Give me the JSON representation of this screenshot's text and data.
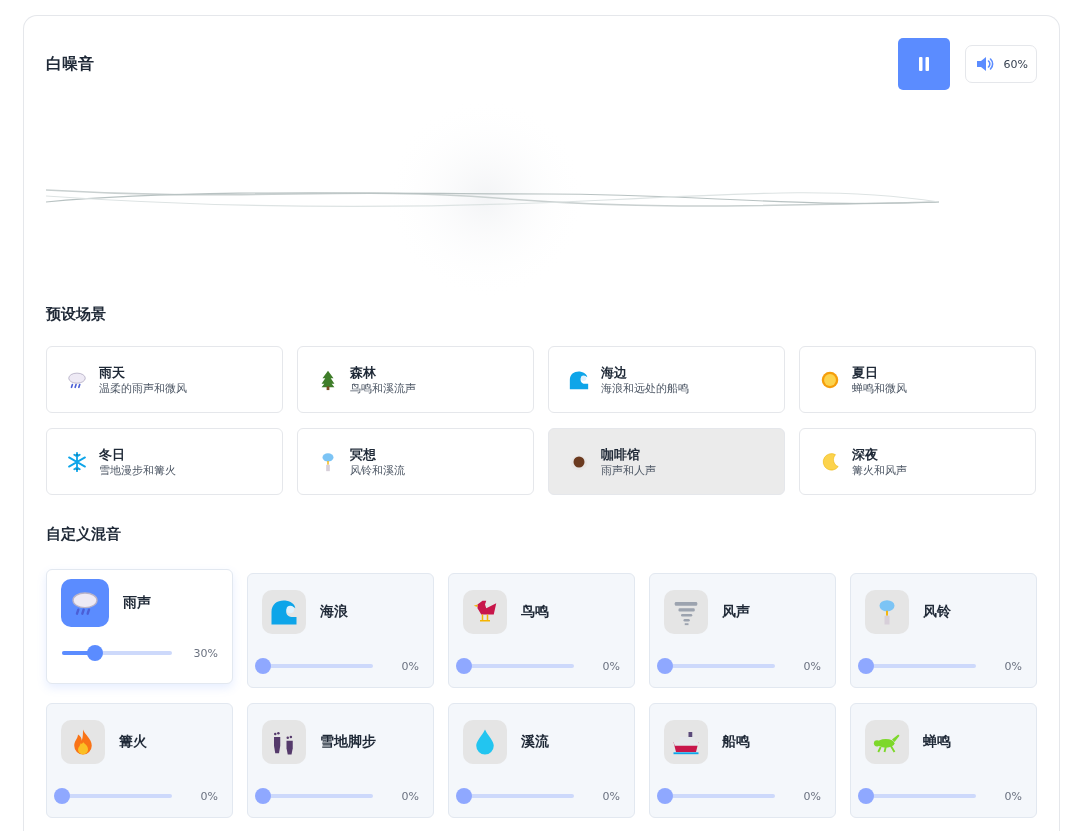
{
  "title": "白噪音",
  "player": {
    "playing": true,
    "volume": "60%"
  },
  "presets_heading": "预设场景",
  "presets": [
    {
      "name": "雨天",
      "description": "温柔的雨声和微风",
      "selected": false
    },
    {
      "name": "森林",
      "description": "鸟鸣和溪流声",
      "selected": false
    },
    {
      "name": "海边",
      "description": "海浪和远处的船鸣",
      "selected": false
    },
    {
      "name": "夏日",
      "description": "蝉鸣和微风",
      "selected": false
    },
    {
      "name": "冬日",
      "description": "雪地漫步和篝火",
      "selected": false
    },
    {
      "name": "冥想",
      "description": "风铃和溪流",
      "selected": false
    },
    {
      "name": "咖啡馆",
      "description": "雨声和人声",
      "selected": true
    },
    {
      "name": "深夜",
      "description": "篝火和风声",
      "selected": false
    }
  ],
  "mixer_heading": "自定义混音",
  "mixer": [
    {
      "name": "雨声",
      "level": 0.3,
      "reading": "30%",
      "selected": true
    },
    {
      "name": "海浪",
      "level": 0,
      "reading": "0%",
      "selected": false
    },
    {
      "name": "鸟鸣",
      "level": 0,
      "reading": "0%",
      "selected": false
    },
    {
      "name": "风声",
      "level": 0,
      "reading": "0%",
      "selected": false
    },
    {
      "name": "风铃",
      "level": 0,
      "reading": "0%",
      "selected": false
    },
    {
      "name": "篝火",
      "level": 0,
      "reading": "0%",
      "selected": false
    },
    {
      "name": "雪地脚步",
      "level": 0,
      "reading": "0%",
      "selected": false
    },
    {
      "name": "溪流",
      "level": 0,
      "reading": "0%",
      "selected": false
    },
    {
      "name": "船鸣",
      "level": 0,
      "reading": "0%",
      "selected": false
    },
    {
      "name": "蝉鸣",
      "level": 0,
      "reading": "0%",
      "selected": false
    }
  ]
}
